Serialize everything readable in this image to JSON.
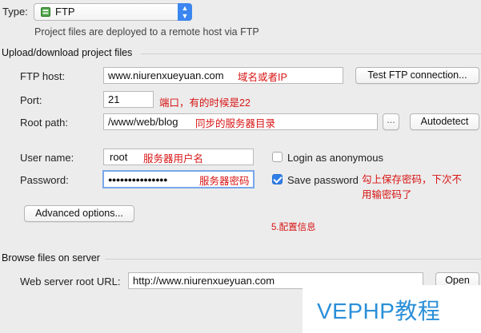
{
  "type_row": {
    "label": "Type:",
    "selected": "FTP",
    "description": "Project files are deployed to a remote host via FTP"
  },
  "upload_section": {
    "title": "Upload/download project files",
    "ftp_host": {
      "label": "FTP host:",
      "value": "www.niurenxueyuan.com",
      "annotation": "域名或者IP"
    },
    "test_button": "Test FTP connection...",
    "port": {
      "label": "Port:",
      "value": "21",
      "annotation": "端口，有的时候是22"
    },
    "root_path": {
      "label": "Root path:",
      "value": "/www/web/blog",
      "annotation": "同步的服务器目录"
    },
    "browse_button": "...",
    "autodetect_button": "Autodetect",
    "user_name": {
      "label": "User name:",
      "value": "root",
      "annotation": "服务器用户名"
    },
    "anonymous": {
      "label": "Login as anonymous",
      "checked": false
    },
    "password": {
      "label": "Password:",
      "value": "●●●●●●●●●●●●●●●",
      "annotation": "服务器密码"
    },
    "save_password": {
      "label": "Save password",
      "checked": true,
      "annotation_line1": "勾上保存密码，下次不",
      "annotation_line2": "用输密码了"
    },
    "advanced_button": "Advanced options...",
    "note": "5.配置信息"
  },
  "browse_section": {
    "title": "Browse files on server",
    "web_root": {
      "label": "Web server root URL:",
      "value": "http://www.niurenxueyuan.com"
    },
    "open_button": "Open"
  },
  "watermark": {
    "text": "VEPHP教程"
  },
  "colors": {
    "annotation": "#d81414",
    "accent": "#3b86f0",
    "watermark": "#2a8fd8"
  }
}
